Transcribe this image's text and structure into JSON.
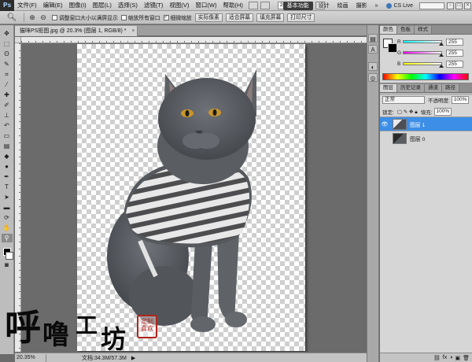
{
  "app": {
    "logo": "Ps",
    "menus": [
      "文件(F)",
      "编辑(E)",
      "图像(I)",
      "图层(L)",
      "选择(S)",
      "滤镜(T)",
      "视图(V)",
      "窗口(W)",
      "帮助(H)"
    ],
    "zoom_menu_value": "20.3",
    "workspaces": [
      "基本功能",
      "设计",
      "绘画",
      "摄影"
    ],
    "active_workspace": "基本功能",
    "more_label": "»",
    "cslive_label": "CS Live"
  },
  "options": {
    "tool_icon": "zoom-icon",
    "checkbox_resize": "调整窗口大小以满屏显示",
    "checkbox_all_windows": "缩放所有窗口",
    "checkbox_scrubby": "细微缩放",
    "btn_actual": "实际像素",
    "btn_fit": "适合屏幕",
    "btn_fill": "填充屏幕",
    "btn_print": "打印尺寸"
  },
  "document": {
    "tab_label": "猫咪PS抠图.jpg @ 20.3% (图层 1, RGB/8) *",
    "close_glyph": "×"
  },
  "status": {
    "zoom": "20.35%",
    "doc_info": "文档:34.3M/57.3M",
    "arrow": "▶"
  },
  "watermark": {
    "chars": [
      "呼",
      "噜",
      "工",
      "坊"
    ],
    "seal_text": "定制 喜欢"
  },
  "panels": {
    "color_tabs": [
      "颜色",
      "色板",
      "样式"
    ],
    "sliders": [
      {
        "label": "R",
        "value": "255",
        "level": 1.0,
        "gradient": "#00ffff,#ffffff"
      },
      {
        "label": "G",
        "value": "255",
        "level": 1.0,
        "gradient": "#ff00ff,#ffffff"
      },
      {
        "label": "B",
        "value": "255",
        "level": 1.0,
        "gradient": "#ffff00,#ffffff"
      }
    ],
    "layer_tabs": [
      "图层",
      "历史记录",
      "通道",
      "路径"
    ],
    "blend_mode": "正常",
    "opacity_label": "不透明度:",
    "opacity_value": "100%",
    "lock_label": "锁定:",
    "fill_label": "填充:",
    "fill_value": "100%",
    "layers": [
      {
        "name": "图层 1",
        "selected": true
      },
      {
        "name": "图层 0",
        "selected": false
      }
    ]
  },
  "colors": {
    "accent": "#3d8ee6",
    "seal": "#b2241c"
  }
}
